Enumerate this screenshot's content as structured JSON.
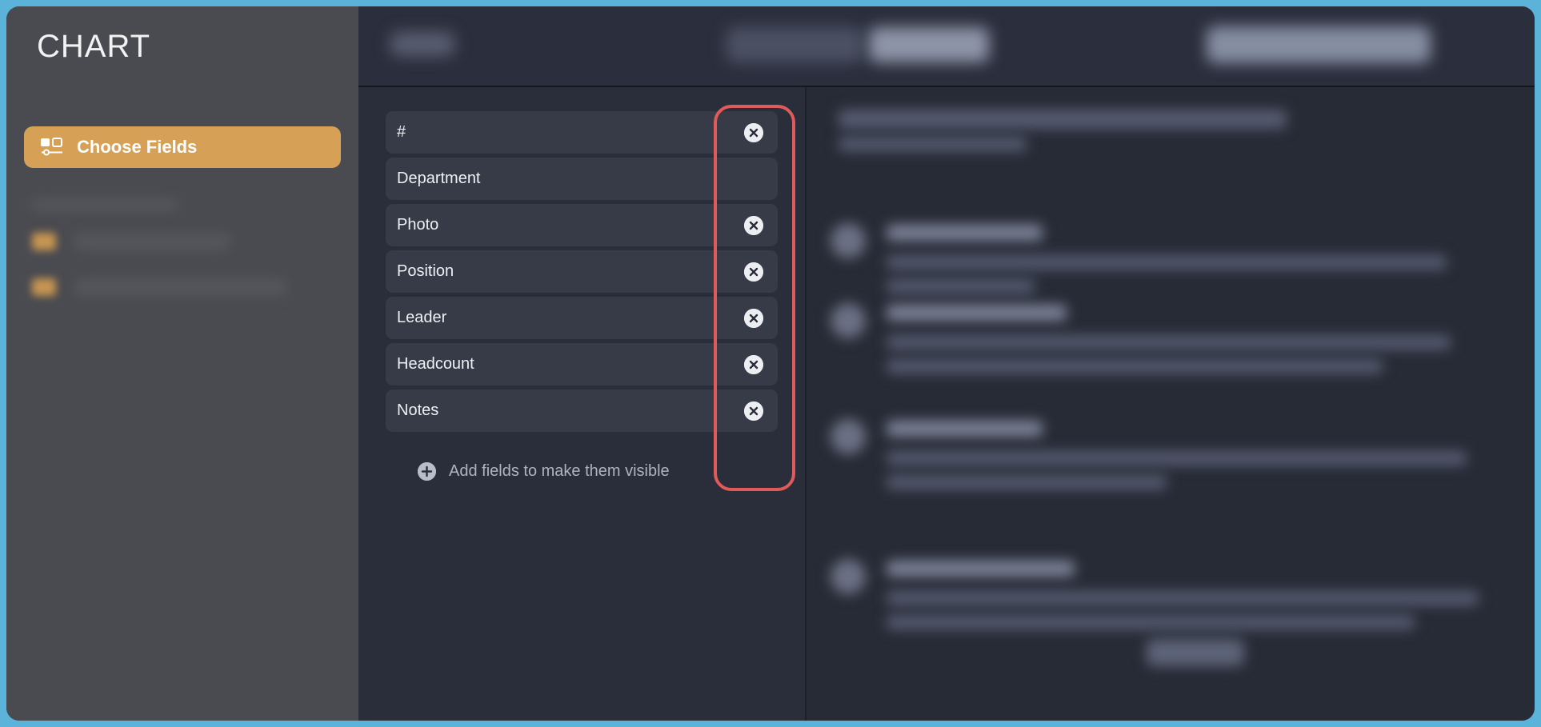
{
  "window": {
    "border_color": "#5cb3d9",
    "background": "#2d303c"
  },
  "sidebar": {
    "title": "CHART",
    "background": "#4a4b50",
    "primary_button": {
      "label": "Choose Fields",
      "icon": "fields-layout-icon",
      "accent_color": "#d6a056"
    },
    "blurred_section_note": "section heading and two accent-bulleted list items are visually blurred and unreadable"
  },
  "header": {
    "background": "#2b2f3d",
    "blurred_note": "left button, a center two-segment control, and a right wide pill button are blurred and unreadable"
  },
  "fields_panel": {
    "background": "#2a2e3a",
    "row_background": "#373b47",
    "fields": [
      {
        "label": "#",
        "removable": true
      },
      {
        "label": "Department",
        "removable": false
      },
      {
        "label": "Photo",
        "removable": true
      },
      {
        "label": "Position",
        "removable": true
      },
      {
        "label": "Leader",
        "removable": true
      },
      {
        "label": "Headcount",
        "removable": true
      },
      {
        "label": "Notes",
        "removable": true
      }
    ],
    "remove_icon": "close-circle-icon",
    "add_fields": {
      "label": "Add fields to make them visible",
      "icon": "plus-circle-icon"
    }
  },
  "annotation": {
    "shape": "rounded-rectangle",
    "color": "#e05a5a",
    "target": "column of remove (x) buttons on the field rows"
  },
  "detail_panel": {
    "background": "#272b36",
    "blurred_note": "four blurred list entries each with a circular avatar, a title line and two body text lines, plus a blurred button near the bottom",
    "item_count": 4
  }
}
